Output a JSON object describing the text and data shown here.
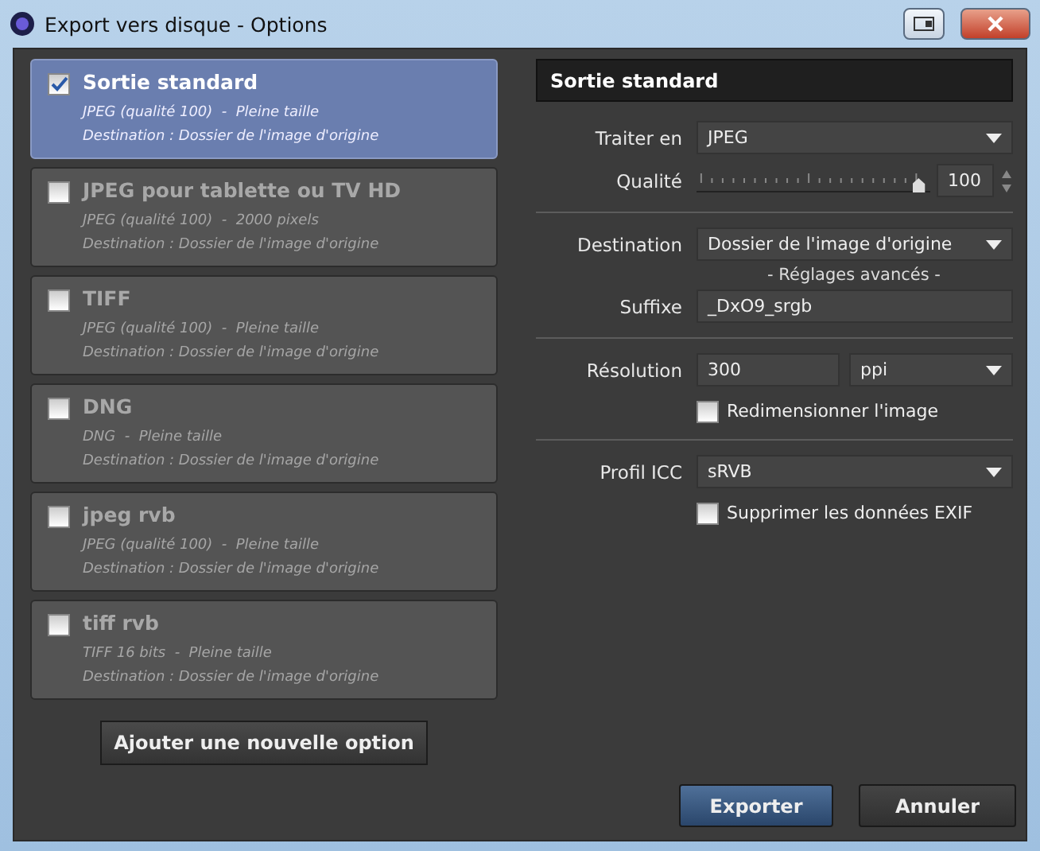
{
  "window": {
    "title": "Export vers disque - Options"
  },
  "options": [
    {
      "name": "Sortie standard",
      "selected": true,
      "checked": true,
      "format": "JPEG (qualité 100)  -  Pleine taille",
      "destination": "Destination : Dossier de l'image d'origine"
    },
    {
      "name": "JPEG pour tablette ou TV HD",
      "selected": false,
      "checked": false,
      "format": "JPEG (qualité 100)  -  2000 pixels",
      "destination": "Destination : Dossier de l'image d'origine"
    },
    {
      "name": "TIFF",
      "selected": false,
      "checked": false,
      "format": "JPEG (qualité 100)  -  Pleine taille",
      "destination": "Destination : Dossier de l'image d'origine"
    },
    {
      "name": "DNG",
      "selected": false,
      "checked": false,
      "format": "DNG  -  Pleine taille",
      "destination": "Destination : Dossier de l'image d'origine"
    },
    {
      "name": "jpeg rvb",
      "selected": false,
      "checked": false,
      "format": "JPEG (qualité 100)  -  Pleine taille",
      "destination": "Destination : Dossier de l'image d'origine"
    },
    {
      "name": "tiff rvb",
      "selected": false,
      "checked": false,
      "format": "TIFF 16 bits  -  Pleine taille",
      "destination": "Destination : Dossier de l'image d'origine"
    }
  ],
  "add_button": "Ajouter une nouvelle option",
  "settings": {
    "title": "Sortie standard",
    "rows": [
      {
        "kind": "select",
        "label": "Traiter en",
        "value": "JPEG"
      },
      {
        "kind": "slider",
        "label": "Qualité",
        "level": 0.95,
        "value": "100"
      },
      {
        "kind": "divider"
      },
      {
        "kind": "select",
        "label": "Destination",
        "value": "Dossier de l'image d'origine"
      },
      {
        "kind": "caption",
        "text": "- Réglages avancés -"
      },
      {
        "kind": "text",
        "label": "Suffixe",
        "value": "_DxO9_srgb"
      },
      {
        "kind": "divider"
      },
      {
        "kind": "unit",
        "label": "Résolution",
        "value": "300",
        "unit": "ppi"
      },
      {
        "kind": "checkbox",
        "text": "Redimensionner l'image",
        "checked": false
      },
      {
        "kind": "divider"
      },
      {
        "kind": "select",
        "label": "Profil ICC",
        "value": "sRVB"
      },
      {
        "kind": "checkbox",
        "text": "Supprimer les données EXIF",
        "checked": false
      }
    ]
  },
  "buttons": [
    {
      "label": "Exporter",
      "kind": "primary"
    },
    {
      "label": "Annuler",
      "kind": "secondary"
    }
  ]
}
